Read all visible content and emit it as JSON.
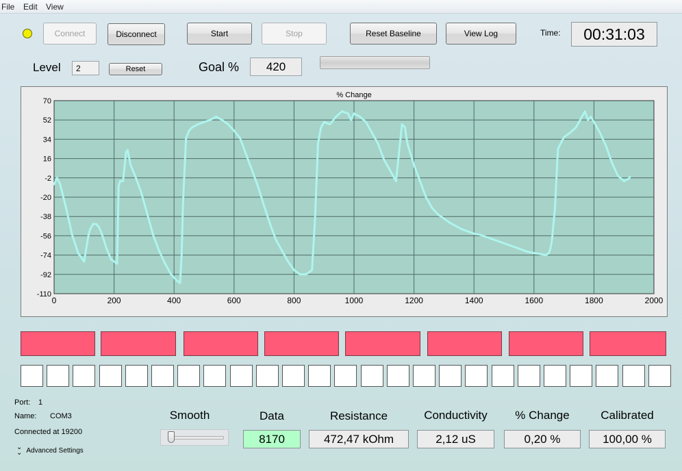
{
  "menu": [
    "File",
    "Edit",
    "View"
  ],
  "toolbar": {
    "connect": "Connect",
    "disconnect": "Disconnect",
    "start": "Start",
    "stop": "Stop",
    "reset_baseline": "Reset Baseline",
    "view_log": "View Log",
    "time_label": "Time:",
    "time_value": "00:31:03"
  },
  "level": {
    "label": "Level",
    "value": "2",
    "reset": "Reset"
  },
  "goal": {
    "label": "Goal %",
    "value": "420"
  },
  "colors": {
    "status_led": "#f2ee00",
    "plot_bg": "#a6d2c8",
    "trace": "#aff4ee",
    "red_indicator": "#ff5a78",
    "data_field": "#b3ffc9"
  },
  "chart_data": {
    "type": "scatter",
    "title": "% Change",
    "xlabel": "",
    "ylabel": "",
    "xlim": [
      0,
      2000
    ],
    "ylim": [
      -110,
      70
    ],
    "xticks": [
      0,
      200,
      400,
      600,
      800,
      1000,
      1200,
      1400,
      1600,
      1800,
      2000
    ],
    "yticks": [
      70,
      52,
      34,
      16,
      -2,
      -20,
      -38,
      -56,
      -74,
      -92,
      -110
    ],
    "grid": true,
    "series": [
      {
        "x": [
          0,
          10,
          20,
          40,
          60,
          80,
          100,
          115,
          120,
          130,
          140,
          150,
          160,
          175,
          190,
          210,
          215,
          220,
          230,
          240,
          245,
          255,
          270,
          290,
          310,
          330,
          350,
          370,
          390,
          410,
          420,
          425,
          430,
          440,
          450,
          460,
          480,
          500,
          520,
          540,
          560,
          580,
          600,
          620,
          640,
          660,
          680,
          700,
          720,
          740,
          760,
          780,
          800,
          820,
          840,
          860,
          870,
          880,
          890,
          900,
          920,
          940,
          960,
          980,
          990,
          1000,
          1020,
          1040,
          1060,
          1080,
          1100,
          1120,
          1140,
          1160,
          1170,
          1175,
          1180,
          1200,
          1220,
          1240,
          1260,
          1280,
          1300,
          1320,
          1340,
          1360,
          1380,
          1400,
          1420,
          1440,
          1460,
          1480,
          1500,
          1520,
          1540,
          1560,
          1580,
          1600,
          1620,
          1640,
          1650,
          1655,
          1660,
          1670,
          1680,
          1700,
          1720,
          1740,
          1760,
          1770,
          1780,
          1790,
          1800,
          1820,
          1840,
          1860,
          1880,
          1900,
          1915,
          1920
        ],
        "y": [
          -8,
          -2,
          -8,
          -30,
          -55,
          -72,
          -80,
          -55,
          -50,
          -45,
          -45,
          -48,
          -55,
          -68,
          -78,
          -82,
          -10,
          -5,
          -5,
          22,
          24,
          10,
          0,
          -15,
          -35,
          -55,
          -70,
          -82,
          -92,
          -98,
          -100,
          -75,
          -25,
          35,
          42,
          45,
          48,
          50,
          52,
          55,
          52,
          48,
          42,
          35,
          20,
          5,
          -10,
          -28,
          -45,
          -60,
          -70,
          -80,
          -88,
          -92,
          -92,
          -88,
          -40,
          30,
          45,
          50,
          48,
          55,
          60,
          58,
          52,
          58,
          55,
          50,
          40,
          30,
          15,
          5,
          -5,
          48,
          45,
          35,
          28,
          10,
          -5,
          -20,
          -30,
          -36,
          -40,
          -44,
          -47,
          -50,
          -52,
          -54,
          -55,
          -57,
          -59,
          -61,
          -63,
          -65,
          -67,
          -69,
          -71,
          -72,
          -73,
          -74,
          -72,
          -68,
          -60,
          -30,
          25,
          36,
          40,
          45,
          55,
          60,
          52,
          55,
          50,
          40,
          28,
          12,
          0,
          -5,
          -3,
          -1
        ]
      }
    ]
  },
  "port": {
    "port_label": "Port:",
    "port_value": "1",
    "name_label": "Name:",
    "name_value": "COM3",
    "connected": "Connected at 19200",
    "advanced": "Advanced Settings"
  },
  "readouts": {
    "smooth_label": "Smooth",
    "smooth_value": 0.05,
    "data_label": "Data",
    "data_value": "8170",
    "resistance_label": "Resistance",
    "resistance_value": "472,47 kOhm",
    "conductivity_label": "Conductivity",
    "conductivity_value": "2,12 uS",
    "pct_change_label": "% Change",
    "pct_change_value": "0,20 %",
    "calibrated_label": "Calibrated",
    "calibrated_value": "100,00 %"
  }
}
